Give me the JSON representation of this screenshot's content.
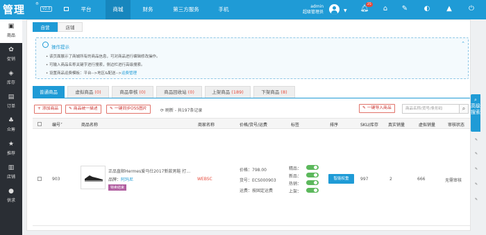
{
  "app": {
    "logo": "管理",
    "logo_mark": "®",
    "version": "V2.0"
  },
  "topnav": [
    {
      "label": "平台",
      "active": false
    },
    {
      "label": "商城",
      "active": true
    },
    {
      "label": "财务",
      "active": false
    },
    {
      "label": "第三方服务",
      "active": false
    },
    {
      "label": "手机",
      "active": false
    }
  ],
  "user": {
    "name": "admin",
    "role": "超级管理员",
    "notification_count": "25"
  },
  "sidebar": [
    {
      "label": "商品",
      "icon": "bag-icon",
      "active": true
    },
    {
      "label": "促销",
      "icon": "promotion-icon",
      "active": false
    },
    {
      "label": "库存",
      "icon": "tag-icon",
      "active": false
    },
    {
      "label": "订单",
      "icon": "order-icon",
      "active": false
    },
    {
      "label": "众筹",
      "icon": "crowdfund-icon",
      "active": false
    },
    {
      "label": "推荐",
      "icon": "star-icon",
      "active": false
    },
    {
      "label": "店铺",
      "icon": "store-icon",
      "active": false
    },
    {
      "label": "供求",
      "icon": "supply-icon",
      "active": false
    }
  ],
  "top_tabs": [
    {
      "label": "自营",
      "active": true
    },
    {
      "label": "店铺",
      "active": false
    }
  ],
  "tips": {
    "title": "操作提示",
    "lines": [
      "该页面展示了商城所有的商品信息，可对商品进行编辑修改操作。",
      "可输入商品名称关键字进行搜索，侧边栏进行高级搜索。",
      "设置商品运费模板：平台-->地区&配送-->"
    ],
    "link": "运费管理"
  },
  "goods_tabs": [
    {
      "label": "普通商品",
      "count": "",
      "active": true
    },
    {
      "label": "虚拟商品",
      "count": "(0)",
      "active": false
    },
    {
      "label": "商品审核",
      "count": "(0)",
      "active": false
    },
    {
      "label": "商品回收站",
      "count": "(0)",
      "active": false
    },
    {
      "label": "上架商品",
      "count": "(189)",
      "active": false
    },
    {
      "label": "下架商品",
      "count": "(8)",
      "active": false
    }
  ],
  "toolbar": {
    "add": "添加商品",
    "batch": "商品统一描述",
    "oss": "一键同步OSS图片",
    "refresh": "刷新 - 共197条记录",
    "import": "一键导入商品",
    "search_placeholder": "商品名称/货号/条形码"
  },
  "table_headers": [
    "编号",
    "商品名称",
    "商家名称",
    "价格/货号/运费",
    "标签",
    "排序",
    "SKU/库存",
    "真实销量",
    "虚拟销量",
    "审核状态"
  ],
  "rows": [
    {
      "id": "903",
      "name": "正品直邮Hermes爱马仕2017新款男鞋 打...",
      "brand_label": "品牌：",
      "brand": "阿玛尼",
      "special": "特卖结束",
      "merchant": "WEBSC",
      "price": "价格：798.00",
      "sku_no": "货号：ECS000903",
      "freight": "运费：按固定运费",
      "labels": [
        "精品：",
        "新品：",
        "热销：",
        "上架："
      ],
      "sort_button": "智能权重",
      "stock": "997",
      "real_sales": "2",
      "virtual_sales": "666",
      "audit": "无需审核"
    }
  ],
  "side_panel": {
    "label": "高级搜索"
  }
}
